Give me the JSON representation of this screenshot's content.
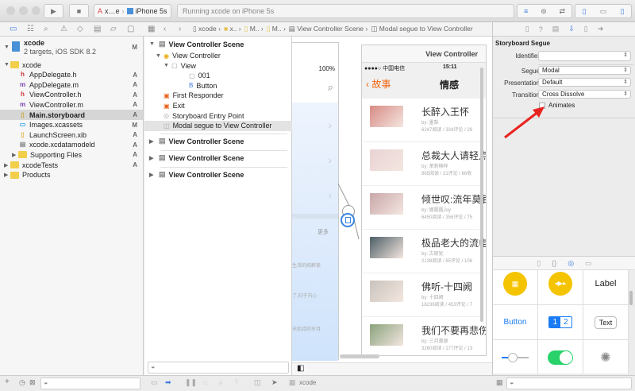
{
  "toolbar": {
    "scheme": "x…e",
    "device": "iPhone 5s",
    "status": "Running xcode on iPhone 5s"
  },
  "jumpbar": {
    "items": [
      "xcode",
      "x..",
      "M..",
      "M..",
      "View Controller Scene",
      "Modal segue to View Controller"
    ]
  },
  "navigator": {
    "project": {
      "name": "xcode",
      "subtitle": "2 targets, iOS SDK 8.2",
      "status": "M"
    },
    "files": [
      {
        "name": "xcode",
        "icon": "folder",
        "status": "",
        "depth": 1,
        "open": true
      },
      {
        "name": "AppDelegate.h",
        "icon": "h",
        "status": "A",
        "depth": 2
      },
      {
        "name": "AppDelegate.m",
        "icon": "m",
        "status": "A",
        "depth": 2
      },
      {
        "name": "ViewController.h",
        "icon": "h",
        "status": "A",
        "depth": 2
      },
      {
        "name": "ViewController.m",
        "icon": "m",
        "status": "A",
        "depth": 2
      },
      {
        "name": "Main.storyboard",
        "icon": "storyboard",
        "status": "A",
        "depth": 2,
        "selected": true
      },
      {
        "name": "Images.xcassets",
        "icon": "xcassets",
        "status": "M",
        "depth": 2
      },
      {
        "name": "LaunchScreen.xib",
        "icon": "xib",
        "status": "A",
        "depth": 2
      },
      {
        "name": "xcode.xcdatamodeld",
        "icon": "datamodel",
        "status": "A",
        "depth": 2
      },
      {
        "name": "Supporting Files",
        "icon": "folder",
        "status": "A",
        "depth": 2,
        "closed": true
      },
      {
        "name": "xcodeTests",
        "icon": "folder",
        "status": "A",
        "depth": 1,
        "closed": true
      },
      {
        "name": "Products",
        "icon": "folder",
        "status": "",
        "depth": 1,
        "closed": true
      }
    ]
  },
  "outline": {
    "scene1": "View Controller Scene",
    "items": [
      {
        "label": "View Controller",
        "depth": 1
      },
      {
        "label": "View",
        "depth": 2
      },
      {
        "label": "001",
        "depth": 3
      },
      {
        "label": "Button",
        "depth": 3
      },
      {
        "label": "First Responder",
        "depth": 1
      },
      {
        "label": "Exit",
        "depth": 1
      },
      {
        "label": "Storyboard Entry Point",
        "depth": 1
      },
      {
        "label": "Modal segue to View Controller",
        "depth": 1,
        "selected": true
      }
    ],
    "scenes": [
      "View Controller Scene",
      "View Controller Scene",
      "View Controller Scene"
    ]
  },
  "canvas": {
    "left_battery": "100%",
    "left_more": "更多",
    "left_lines": [
      "生活的纯粹美",
      "了,归于内心",
      "天如诗的岁月"
    ],
    "vc_title": "View Controller",
    "carrier": "●●●●○ 中国电信",
    "time": "15:11",
    "back": "故事",
    "nav_title": "情感",
    "stories": [
      {
        "title": "长醉入王怀",
        "by": "by: 墨梨",
        "stats": "6247阅读 / 334评论 / 26",
        "color": "#d98a84"
      },
      {
        "title": "总裁大人请轻点",
        "by": "by: 茉莉楠梓",
        "stats": "865阅读 / 31评论 / 66收",
        "color": "#e9d3d4"
      },
      {
        "title": "倾世叹:流年莫钅",
        "by": "by: 娜圆圆Joy",
        "stats": "6450阅读 / 356评论 / 75",
        "color": "#c9a7a8"
      },
      {
        "title": "极品老大的流电",
        "by": "by: 古原犹",
        "stats": "2138阅读 / 85评论 / 106",
        "color": "#4d5f66"
      },
      {
        "title": "佛听-十四阙",
        "by": "by: 十四阙",
        "stats": "18236阅读 / 453评论 / 7",
        "color": "#c9c3bd"
      },
      {
        "title": "我们不要再悲伤",
        "by": "by: 三月蔷瑟",
        "stats": "3260阅读 / 177评论 / 13",
        "color": "#8aa27c"
      }
    ]
  },
  "inspector": {
    "title": "Storyboard Segue",
    "identifier_label": "Identifier",
    "identifier_value": "",
    "segue_label": "Segue",
    "segue": "Modal",
    "presentation_label": "Presentation",
    "presentation": "Default",
    "transition_label": "Transition",
    "transition": "Cross Dissolve",
    "animates_label": "Animates",
    "animates": false
  },
  "library": {
    "label": "Label",
    "button": "Button",
    "seg1": "1",
    "seg2": "2",
    "text": "Text"
  },
  "bottom": {
    "target": "xcode"
  },
  "colors": {
    "accent": "#1a7cf5",
    "orange": "#f0640f",
    "arrow": "#e8231f"
  }
}
